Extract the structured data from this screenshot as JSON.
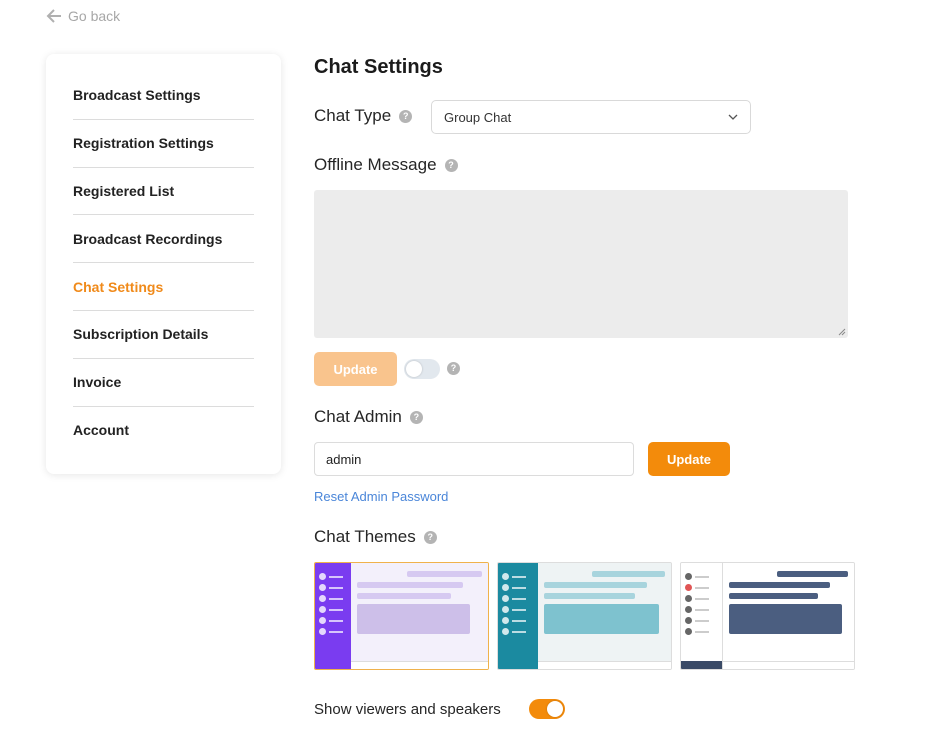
{
  "nav": {
    "go_back": "Go back"
  },
  "sidebar": {
    "items": [
      {
        "label": "Broadcast Settings",
        "active": false
      },
      {
        "label": "Registration Settings",
        "active": false
      },
      {
        "label": "Registered List",
        "active": false
      },
      {
        "label": "Broadcast Recordings",
        "active": false
      },
      {
        "label": "Chat Settings",
        "active": true
      },
      {
        "label": "Subscription Details",
        "active": false
      },
      {
        "label": "Invoice",
        "active": false
      },
      {
        "label": "Account",
        "active": false
      }
    ]
  },
  "main": {
    "title": "Chat Settings",
    "chat_type": {
      "label": "Chat Type",
      "selected": "Group Chat"
    },
    "offline_message": {
      "label": "Offline Message",
      "value": "",
      "update_label": "Update",
      "toggle_on": false
    },
    "chat_admin": {
      "label": "Chat Admin",
      "value": "admin",
      "update_label": "Update",
      "reset_link": "Reset Admin Password"
    },
    "chat_themes": {
      "label": "Chat Themes",
      "selected_index": 0,
      "themes": [
        "purple",
        "teal",
        "white"
      ]
    },
    "show_viewers": {
      "label": "Show viewers and speakers",
      "toggle_on": true
    }
  },
  "colors": {
    "accent": "#f38b0b",
    "accent_disabled": "#f9c48d",
    "active_nav": "#f08a1a",
    "link": "#4a86d9"
  },
  "icons": {
    "back": "arrow-left-icon",
    "help": "question-circle-icon",
    "dropdown": "chevron-down-icon"
  }
}
